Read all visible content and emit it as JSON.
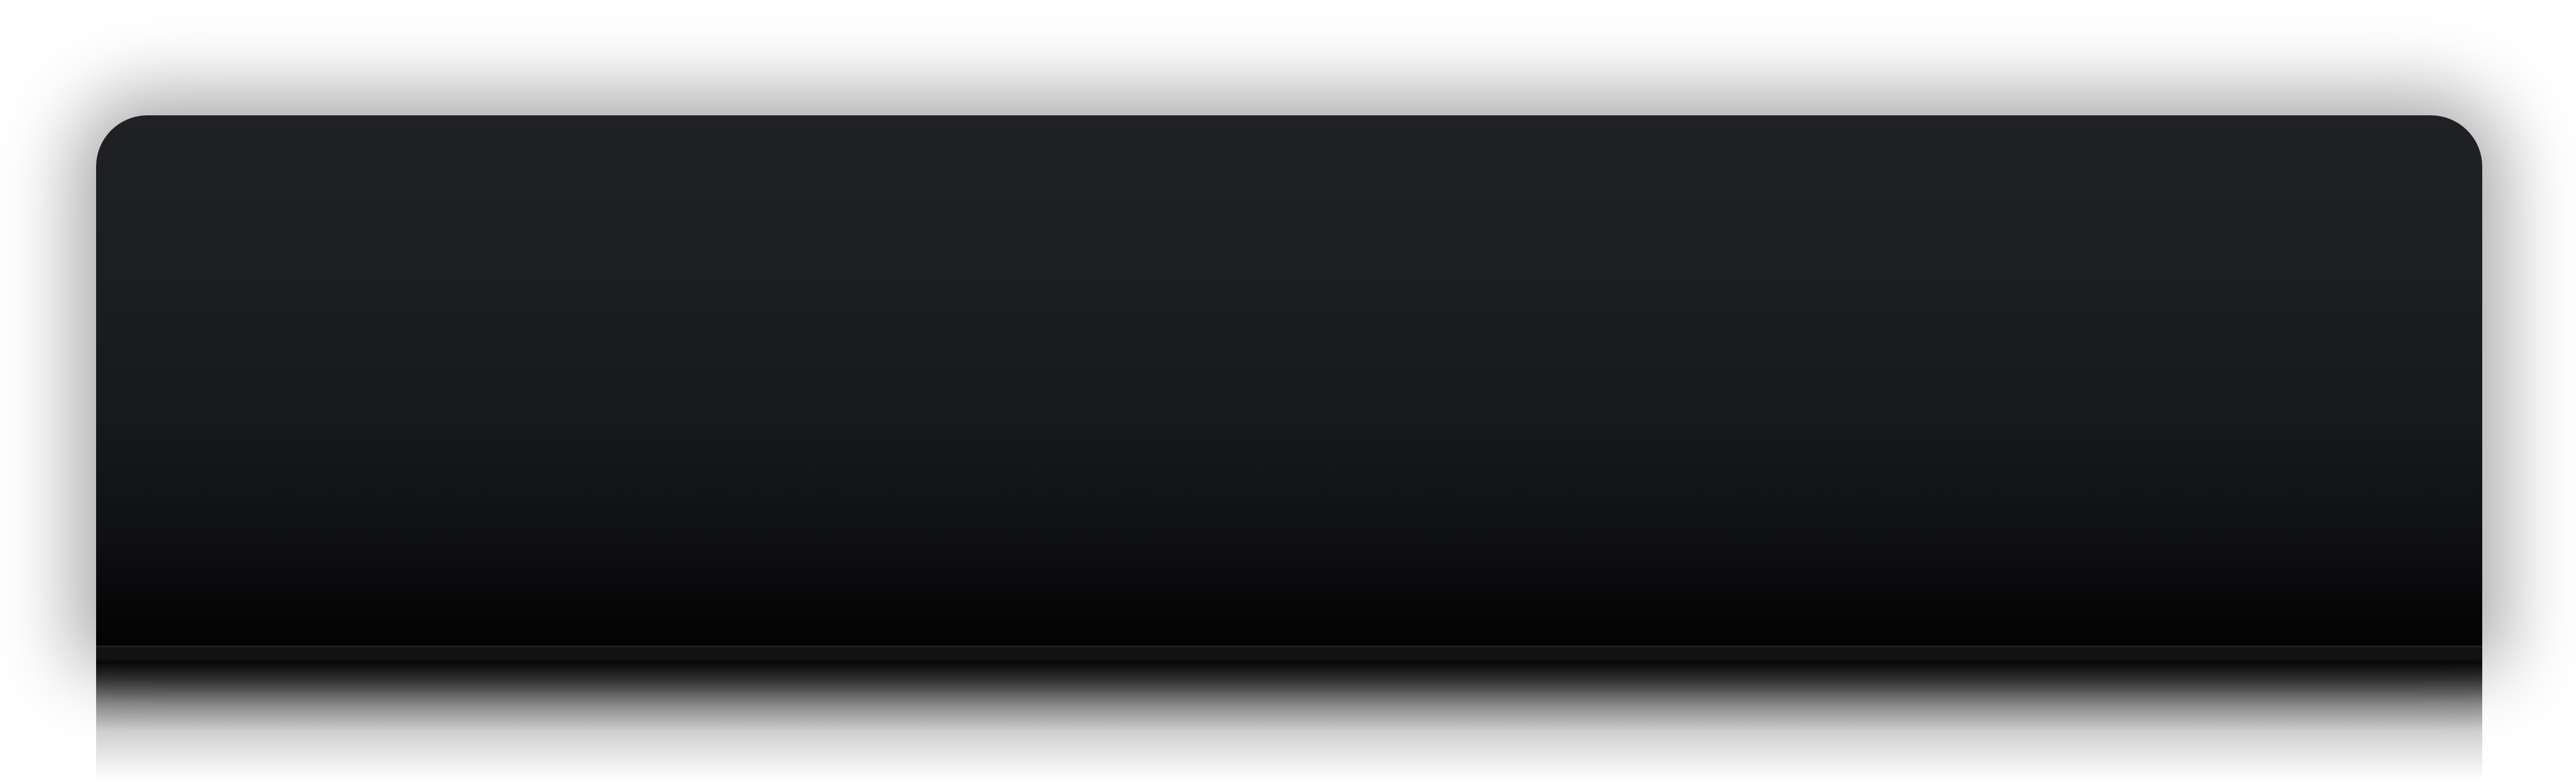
{
  "window": {
    "title": "",
    "content": ""
  },
  "theme": {
    "background": "#ffffff",
    "window_top": "#1f2125",
    "window_bottom": "#030303"
  }
}
